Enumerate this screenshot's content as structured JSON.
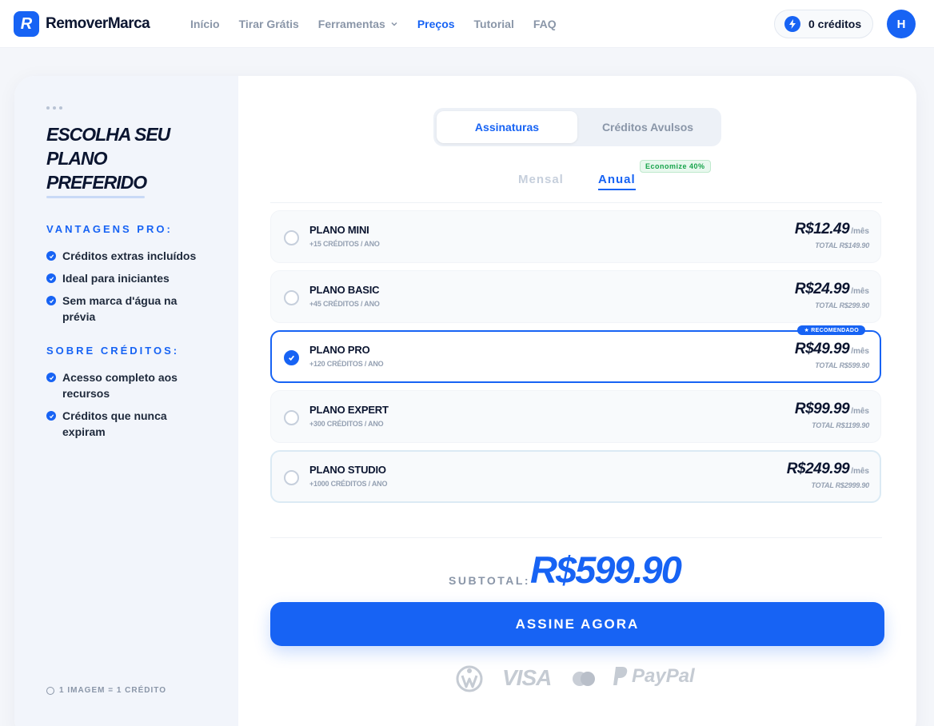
{
  "nav": {
    "logo_mark": "R",
    "brand": "RemoverMarca",
    "links": [
      "Início",
      "Tirar Grátis",
      "Ferramentas",
      "Preços",
      "Tutorial",
      "FAQ"
    ],
    "active_link": "Preços",
    "credits": "0 créditos",
    "avatar": "H"
  },
  "sidebar": {
    "title": "ESCOLHA SEU PLANO PREFERIDO",
    "pro_heading": "VANTAGENS PRO:",
    "pro_items": [
      "Créditos extras incluídos",
      "Ideal para iniciantes",
      "Sem marca d'água na prévia"
    ],
    "credits_heading": "SOBRE CRÉDITOS:",
    "credits_items": [
      "Acesso completo aos recursos",
      "Créditos que nunca expiram"
    ],
    "footer": "1 IMAGEM = 1 CRÉDITO"
  },
  "tabs": {
    "subscriptions": "Assinaturas",
    "credits": "Créditos Avulsos",
    "selected": "Assinaturas"
  },
  "billing": {
    "monthly": "Mensal",
    "annual": "Anual",
    "selected": "Anual",
    "badge": "Economize 40%"
  },
  "plans": [
    {
      "name": "PLANO MINI",
      "credits": "+15 CRÉDITOS / ANO",
      "price": "R$12.49",
      "per": "/mês",
      "total": "TOTAL R$149.90",
      "selected": false
    },
    {
      "name": "PLANO BASIC",
      "credits": "+45 CRÉDITOS / ANO",
      "price": "R$24.99",
      "per": "/mês",
      "total": "TOTAL R$299.90",
      "selected": false
    },
    {
      "name": "PLANO PRO",
      "credits": "+120 CRÉDITOS / ANO",
      "price": "R$49.99",
      "per": "/mês",
      "total": "TOTAL R$599.90",
      "selected": true,
      "badge": "★ RECOMENDADO"
    },
    {
      "name": "PLANO EXPERT",
      "credits": "+300 CRÉDITOS / ANO",
      "price": "R$99.99",
      "per": "/mês",
      "total": "TOTAL R$1199.90",
      "selected": false
    },
    {
      "name": "PLANO STUDIO",
      "credits": "+1000 CRÉDITOS / ANO",
      "price": "R$249.99",
      "per": "/mês",
      "total": "TOTAL R$2999.90",
      "selected": false
    }
  ],
  "subtotal": {
    "label": "SUBTOTAL:",
    "value": "R$599.90"
  },
  "cta": "ASSINE AGORA",
  "payments": {
    "visa": "VISA",
    "paypal": "PayPal",
    "icons": [
      "wise-icon",
      "visa-logo",
      "mastercard-icon",
      "paypal-icon"
    ]
  },
  "colors": {
    "primary": "#1763f4",
    "success": "#16a34a"
  }
}
